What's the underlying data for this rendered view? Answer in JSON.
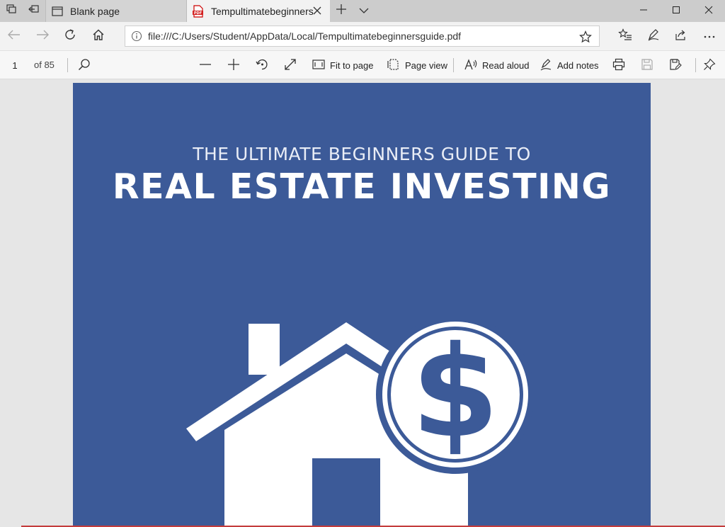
{
  "browser": {
    "tabs": [
      {
        "label": "Blank page",
        "active": false
      },
      {
        "label": "Tempultimatebeginners",
        "active": true
      }
    ],
    "address": {
      "url": "file:///C:/Users/Student/AppData/Local/Tempultimatebeginnersguide.pdf"
    }
  },
  "pdf_toolbar": {
    "page_number": "1",
    "page_total": "of 85",
    "fit_to_page": "Fit to page",
    "page_view": "Page view",
    "read_aloud": "Read aloud",
    "add_notes": "Add notes"
  },
  "document": {
    "kicker": "THE ULTIMATE BEGINNERS GUIDE TO",
    "headline": "REAL ESTATE INVESTING",
    "background_color": "#3c5a98"
  },
  "icons": [
    "tab-actions-icon",
    "set-aside-tabs-icon",
    "page-icon",
    "pdf-icon",
    "close-icon",
    "new-tab-icon",
    "chevron-down-icon",
    "minimize-icon",
    "maximize-icon",
    "window-close-icon",
    "back-icon",
    "forward-icon",
    "refresh-icon",
    "home-icon",
    "info-icon",
    "star-icon",
    "favorites-icon",
    "pen-icon",
    "share-icon",
    "more-icon",
    "search-icon",
    "zoom-out-icon",
    "zoom-in-icon",
    "rotate-icon",
    "fullscreen-icon",
    "fit-page-icon",
    "page-view-icon",
    "read-aloud-icon",
    "add-notes-icon",
    "print-icon",
    "save-icon",
    "save-as-icon",
    "pin-icon",
    "house-icon",
    "dollar-coin-icon"
  ]
}
